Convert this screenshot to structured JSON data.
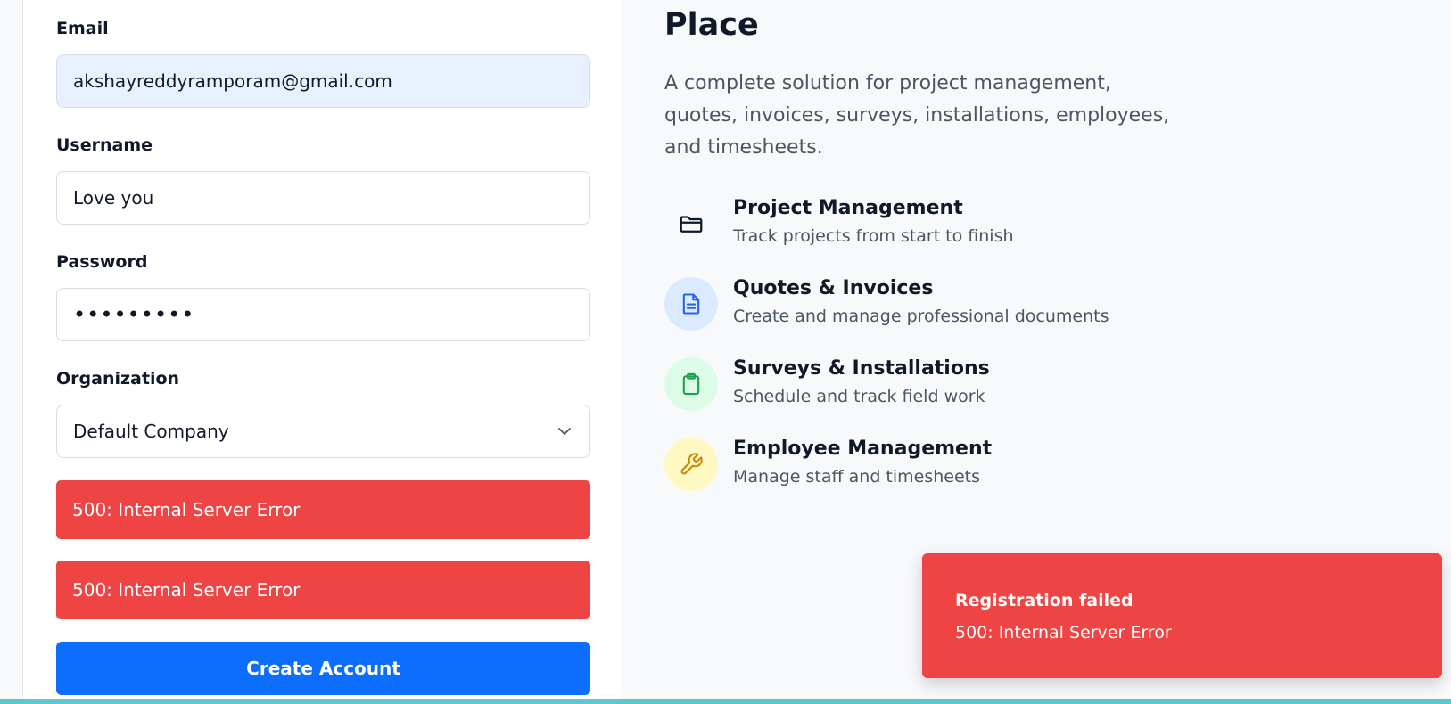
{
  "form": {
    "email": {
      "label": "Email",
      "value": "akshayreddyramporam@gmail.com"
    },
    "username": {
      "label": "Username",
      "value": "Love you"
    },
    "password": {
      "label": "Password",
      "value": "•••••••••"
    },
    "organization": {
      "label": "Organization",
      "value": "Default Company"
    },
    "errors": [
      "500: Internal Server Error",
      "500: Internal Server Error"
    ],
    "submit_label": "Create Account"
  },
  "info": {
    "headline": "Place",
    "subtitle": "A complete solution for project management, quotes, invoices, surveys, installations, employees, and timesheets.",
    "features": [
      {
        "icon": "folder-icon",
        "title": "Project Management",
        "description": "Track projects from start to finish",
        "bg": "transparent",
        "color": "#111827"
      },
      {
        "icon": "document-icon",
        "title": "Quotes & Invoices",
        "description": "Create and manage professional documents",
        "bg": "#dbeafe",
        "color": "#2563eb"
      },
      {
        "icon": "clipboard-icon",
        "title": "Surveys & Installations",
        "description": "Schedule and track field work",
        "bg": "#dcfce7",
        "color": "#16a34a"
      },
      {
        "icon": "wrench-icon",
        "title": "Employee Management",
        "description": "Manage staff and timesheets",
        "bg": "#fef9c3",
        "color": "#ca8a04"
      }
    ]
  },
  "toast": {
    "title": "Registration failed",
    "message": "500: Internal Server Error"
  },
  "colors": {
    "primary": "#0d6efd",
    "error": "#ef4444",
    "accent_bar": "#5bc8cf"
  }
}
